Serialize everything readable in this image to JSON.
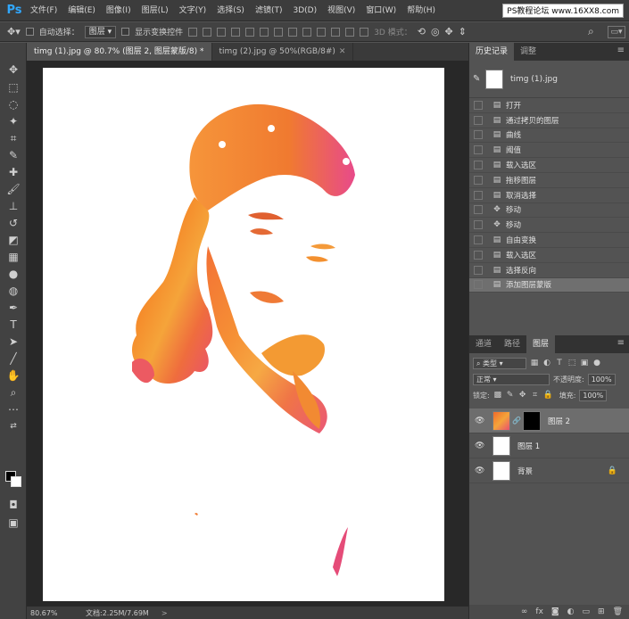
{
  "app": {
    "logo": "Ps",
    "watermark": "PS教程论坛 www.16XX8.com"
  },
  "menubar": {
    "items": [
      "文件(F)",
      "编辑(E)",
      "图像(I)",
      "图层(L)",
      "文字(Y)",
      "选择(S)",
      "滤镜(T)",
      "3D(D)",
      "视图(V)",
      "窗口(W)",
      "帮助(H)"
    ]
  },
  "options": {
    "auto_select_label": "自动选择：",
    "auto_select_value": "图层",
    "show_transform_label": "显示变换控件",
    "mode_3d_label": "3D 模式："
  },
  "tabs": [
    {
      "label": "timg (1).jpg @ 80.7% (图层 2, 图层蒙版/8) *",
      "active": true
    },
    {
      "label": "timg (2).jpg @ 50%(RGB/8#)",
      "active": false
    }
  ],
  "tools": [
    "move-icon",
    "marquee-icon",
    "lasso-icon",
    "magic-wand-icon",
    "crop-icon",
    "eyedropper-icon",
    "healing-icon",
    "brush-icon",
    "stamp-icon",
    "history-brush-icon",
    "eraser-icon",
    "gradient-icon",
    "blur-icon",
    "dodge-icon",
    "pen-icon",
    "type-icon",
    "path-select-icon",
    "line-icon",
    "hand-icon",
    "zoom-icon",
    "more-icon"
  ],
  "colors": {
    "foreground": "#000000",
    "background": "#ffffff",
    "accent": "#31a8ff"
  },
  "status": {
    "zoom": "80.67%",
    "doc": "文档:2.25M/7.69M",
    "arrow": ">"
  },
  "history_panel": {
    "tabs": [
      "历史记录",
      "调整"
    ],
    "snapshot": "timg (1).jpg",
    "items": [
      {
        "label": "打开",
        "icon": "doc-icon"
      },
      {
        "label": "通过拷贝的图层",
        "icon": "doc-icon"
      },
      {
        "label": "曲线",
        "icon": "doc-icon"
      },
      {
        "label": "阈值",
        "icon": "doc-icon"
      },
      {
        "label": "载入选区",
        "icon": "doc-icon"
      },
      {
        "label": "拖移图层",
        "icon": "doc-icon"
      },
      {
        "label": "取消选择",
        "icon": "doc-icon"
      },
      {
        "label": "移动",
        "icon": "move-icon"
      },
      {
        "label": "移动",
        "icon": "move-icon"
      },
      {
        "label": "自由变换",
        "icon": "doc-icon"
      },
      {
        "label": "载入选区",
        "icon": "doc-icon"
      },
      {
        "label": "选择反向",
        "icon": "doc-icon"
      },
      {
        "label": "添加图层蒙版",
        "icon": "doc-icon",
        "selected": true
      }
    ]
  },
  "layers_panel": {
    "tabs": [
      "通道",
      "路径",
      "图层"
    ],
    "filter_label": "类型",
    "blend_mode": "正常",
    "opacity_label": "不透明度:",
    "opacity_value": "100%",
    "lock_label": "锁定:",
    "fill_label": "填充:",
    "fill_value": "100%",
    "layers": [
      {
        "name": "图层 2",
        "active": true,
        "has_mask": true
      },
      {
        "name": "图层 1",
        "active": false
      },
      {
        "name": "背景",
        "active": false,
        "locked": true
      }
    ]
  }
}
